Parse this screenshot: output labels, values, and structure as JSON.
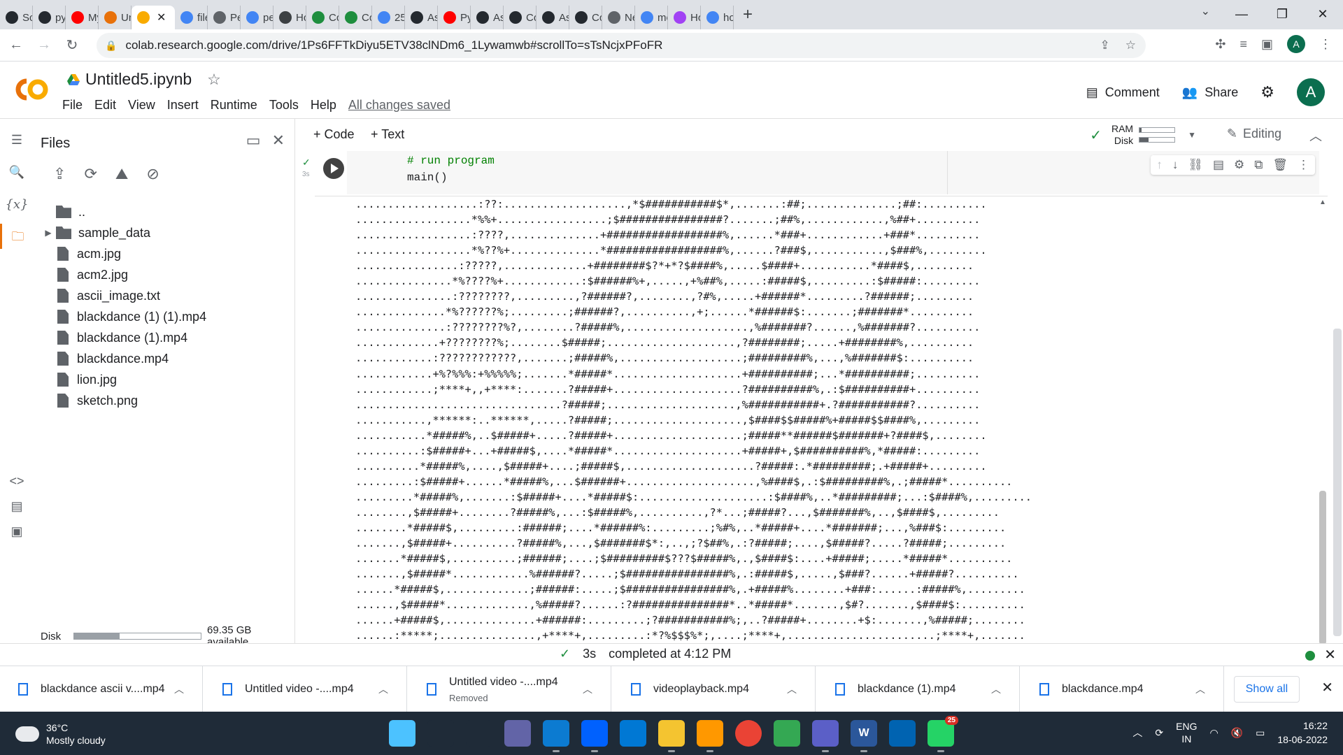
{
  "browser": {
    "tabs": [
      {
        "label": "Scr",
        "icon": "github-icon",
        "color": "#24292f"
      },
      {
        "label": "pyt",
        "icon": "github-icon",
        "color": "#24292f"
      },
      {
        "label": "My",
        "icon": "youtube-icon",
        "color": "#ff0000"
      },
      {
        "label": "Unt",
        "icon": "colab-icon",
        "color": "#e8710a"
      },
      {
        "label": "",
        "icon": "colab-icon",
        "color": "#f9ab00",
        "active": true
      },
      {
        "label": "file",
        "icon": "google-icon",
        "color": "#4285f4"
      },
      {
        "label": "Per",
        "icon": "python-icon",
        "color": "#5f6368"
      },
      {
        "label": "per",
        "icon": "google-icon",
        "color": "#4285f4"
      },
      {
        "label": "Ho",
        "icon": "book-icon",
        "color": "#3c4043"
      },
      {
        "label": "Co",
        "icon": "colab-icon",
        "color": "#1e8e3e"
      },
      {
        "label": "Co",
        "icon": "colab-icon",
        "color": "#1e8e3e"
      },
      {
        "label": "25",
        "icon": "google-icon",
        "color": "#4285f4"
      },
      {
        "label": "Asc",
        "icon": "github-icon",
        "color": "#24292f"
      },
      {
        "label": "Pyt",
        "icon": "youtube-icon",
        "color": "#ff0000"
      },
      {
        "label": "Asc",
        "icon": "github-icon",
        "color": "#24292f"
      },
      {
        "label": "Co",
        "icon": "github-icon",
        "color": "#24292f"
      },
      {
        "label": "Asc",
        "icon": "github-icon",
        "color": "#24292f"
      },
      {
        "label": "Co",
        "icon": "github-icon",
        "color": "#24292f"
      },
      {
        "label": "Ne",
        "icon": "chrome-icon",
        "color": "#5f6368"
      },
      {
        "label": "mo",
        "icon": "google-icon",
        "color": "#4285f4"
      },
      {
        "label": "Ho",
        "icon": "link-icon",
        "color": "#a142f4"
      },
      {
        "label": "ho",
        "icon": "google-icon",
        "color": "#4285f4"
      }
    ],
    "url": "colab.research.google.com/drive/1Ps6FFTkDiyu5ETV38clNDm6_1Lywamwb#scrollTo=sTsNcjxPFoFR",
    "profile_initial": "A"
  },
  "colab": {
    "notebook_title": "Untitled5.ipynb",
    "menu": [
      "File",
      "Edit",
      "View",
      "Insert",
      "Runtime",
      "Tools",
      "Help"
    ],
    "save_status": "All changes saved",
    "comment_label": "Comment",
    "share_label": "Share",
    "avatar_initial": "A"
  },
  "files_panel": {
    "title": "Files",
    "items": [
      {
        "name": "..",
        "type": "parent"
      },
      {
        "name": "sample_data",
        "type": "folder"
      },
      {
        "name": "acm.jpg",
        "type": "file"
      },
      {
        "name": "acm2.jpg",
        "type": "file"
      },
      {
        "name": "ascii_image.txt",
        "type": "file"
      },
      {
        "name": "blackdance (1) (1).mp4",
        "type": "file"
      },
      {
        "name": "blackdance (1).mp4",
        "type": "file"
      },
      {
        "name": "blackdance.mp4",
        "type": "file"
      },
      {
        "name": "lion.jpg",
        "type": "file"
      },
      {
        "name": "sketch.png",
        "type": "file"
      }
    ],
    "disk_label": "Disk",
    "disk_available": "69.35 GB available",
    "disk_used_fraction": 0.36
  },
  "notebook": {
    "add_code": "+ Code",
    "add_text": "+ Text",
    "ram_label": "RAM",
    "disk_label": "Disk",
    "ram_used_fraction": 0.05,
    "disk_used_fraction": 0.25,
    "editing_label": "Editing",
    "cell_exec_time": "3s",
    "code_comment": "# run program",
    "code_call": "main()",
    "output_lines": [
      "...................:??:...................,*$###########$*,.......:##;..............;##:..........",
      "..................*%%+.................;$################?.......;##%,............,%##+..........",
      "..................:????,..............+##################%,......*###+............+###*..........",
      "..................*%??%+..............*##################%,......?###$,...........,$###%,.........",
      "................:?????,.............+########$?*+*?$####%,.....$####+...........*####$,.........",
      "...............*%????%+............:$######%+,.....,+%##%,.....:#####$,.........:$#####:.........",
      "...............:????????,.........,?######?,........,?#%,.....+######*.........?######;.........",
      "..............*%??????%;.........;######?,..........,+;......*######$:.......;#######*..........",
      "..............:????????%?,........?#####%,...................,%#######?......,%#######?..........",
      ".............+????????%;........$#####;....................,?########;.....+########%,..........",
      "............:????????????,.......;#####%,...................;#########%,...,%#######$:..........",
      "............+%?%%%:+%%%%%;.......*#####*....................+##########;...*##########;..........",
      "............;****+,,+****:.......?#####+....................?##########%,.:$##########+..........",
      "................................?#####;....................,%###########+.?###########?..........",
      "...........,******:..******,.....?#####;....................,$####$$#####%+#####$$####%,.........",
      "...........*#####%,..$#####+.....?#####+....................;#####**######$#######+?####$,........",
      "..........:$#####+...+#####$,....*#####*....................+#####+,$##########%,*#####:.........",
      "..........*#####%,....,$#####+....;#####$,....................?#####:.*#########;.+#####+.........",
      ".........:$#####+......*#####%,...$######+....................,%####$,.:$#########%,.;#####*..........",
      ".........*#####%,.......:$#####+....*#####$:....................:$####%,..*#########;...:$####%,.........",
      "........,$#####+........?#####%,...:$#####%,..........,?*...;#####?...,$#######%,..,$####$,.........",
      "........*#####$,.........:######;....*######%:.........;%#%,..*#####+....*#######;...,%###$:.........",
      ".......,$#####+..........?#####%,...,$#######$*:,..,;?$##%,.:?#####;....,$#####?.....?#####;.........",
      ".......*#####$,..........;######;....;$#########$???$#####%,.,$####$:....+#####;.....*#####*..........",
      ".......,$#####*............%######?.....;$################%,.:#####$,.....,$###?......+#####?..........",
      "......*#####$,.............;######:.....;$################%,.+#####%........+###:......:#####%,.........",
      "......,$#####*.............,%#####?......:?###############*..*#####*.......,$#?.......,$####$:..........",
      "......+#####$,..............+######:.........;?###########%;,..?#####+........+$:.......,%#####;........",
      "......:*****;...............,+****+,.........:*?%$$$%*;,....;****+,.......................;****+,......."
    ]
  },
  "statusbar": {
    "exec_time": "3s",
    "completed": "completed at 4:12 PM"
  },
  "downloads": {
    "items": [
      {
        "name": "blackdance ascii v....mp4",
        "sub": ""
      },
      {
        "name": "Untitled video -....mp4",
        "sub": ""
      },
      {
        "name": "Untitled video -....mp4",
        "sub": "Removed"
      },
      {
        "name": "videoplayback.mp4",
        "sub": ""
      },
      {
        "name": "blackdance (1).mp4",
        "sub": ""
      },
      {
        "name": "blackdance.mp4",
        "sub": ""
      }
    ],
    "show_all": "Show all"
  },
  "taskbar": {
    "temp": "36°C",
    "weather": "Mostly cloudy",
    "apps": [
      {
        "icon": "windows-start-icon",
        "color": "#4cc2ff",
        "label": ""
      },
      {
        "icon": "search-icon",
        "color": "#1f2b38",
        "label": ""
      },
      {
        "icon": "task-view-icon",
        "color": "#1f2b38",
        "label": ""
      },
      {
        "icon": "chat-icon",
        "color": "#6264a7",
        "label": ""
      },
      {
        "icon": "edge-icon",
        "color": "#0c7bd1",
        "label": ""
      },
      {
        "icon": "dropbox-icon",
        "color": "#0061fe",
        "label": ""
      },
      {
        "icon": "mail-icon",
        "color": "#0078d4",
        "label": ""
      },
      {
        "icon": "file-explorer-icon",
        "color": "#f4c430",
        "label": ""
      },
      {
        "icon": "sublime-icon",
        "color": "#ff9800",
        "label": ""
      },
      {
        "icon": "chrome-icon",
        "color": "#ea4335",
        "label": ""
      },
      {
        "icon": "globe-icon",
        "color": "#34a853",
        "label": ""
      },
      {
        "icon": "teams-icon",
        "color": "#5b5fc7",
        "label": ""
      },
      {
        "icon": "word-icon",
        "color": "#2b579a",
        "label": "W"
      },
      {
        "icon": "photos-icon",
        "color": "#0063b1",
        "label": ""
      },
      {
        "icon": "whatsapp-icon",
        "color": "#25d366",
        "label": "",
        "badge": "25"
      }
    ],
    "lang_line1": "ENG",
    "lang_line2": "IN",
    "time": "16:22",
    "date": "18-06-2022"
  }
}
